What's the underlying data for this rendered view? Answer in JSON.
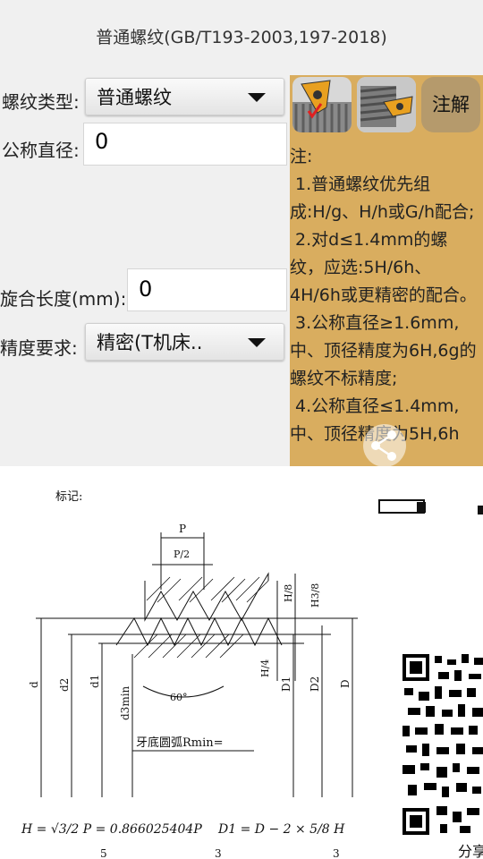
{
  "app": {
    "title": "普通螺纹(GB/T193-2003,197-2018)"
  },
  "form": {
    "thread_type": {
      "label": "螺纹类型:",
      "value": "普通螺纹"
    },
    "nominal_diameter": {
      "label": "公称直径:",
      "value": "0"
    },
    "engagement_length": {
      "label": "旋合长度(mm):",
      "value": "0"
    },
    "precision": {
      "label": "精度要求:",
      "value": "精密(T机床.."
    }
  },
  "notes": {
    "button_label": "注解",
    "text": "注:\n 1.普通螺纹优先组成:H/g、H/h或G/h配合;\n 2.对d≤1.4mm的螺纹，应选:5H/6h、4H/6h或更精密的配合。\n 3.公称直径≥1.6mm,中、顶径精度为6H,6g的螺纹不标精度;\n 4.公称直径≤1.4mm,中、顶径精度为5H,6h"
  },
  "diagram": {
    "mark_label": "标记:",
    "pitch": "P",
    "half_pitch": "P/2",
    "h8": "H/8",
    "h38": "H3/8",
    "h4": "H/4",
    "angle": "60°",
    "d": "d",
    "d2": "d2",
    "d1": "d1",
    "d3min": "d3min",
    "D1": "D1",
    "D2": "D2",
    "D": "D",
    "root_arc": "牙底圆弧Rmin=",
    "formula_h": "H = √3/2 P = 0.866025404P",
    "formula_d1": "D1 = D − 2 × 5/8 H",
    "bottom_nums": [
      "5",
      "3",
      "3"
    ]
  },
  "side": {
    "share_label": "分享"
  },
  "icons": [
    "share-icon",
    "monitor-icon",
    "qr-code",
    "cutting-tool-icon",
    "threaded-rod-icon",
    "dropdown-arrow-icon"
  ]
}
